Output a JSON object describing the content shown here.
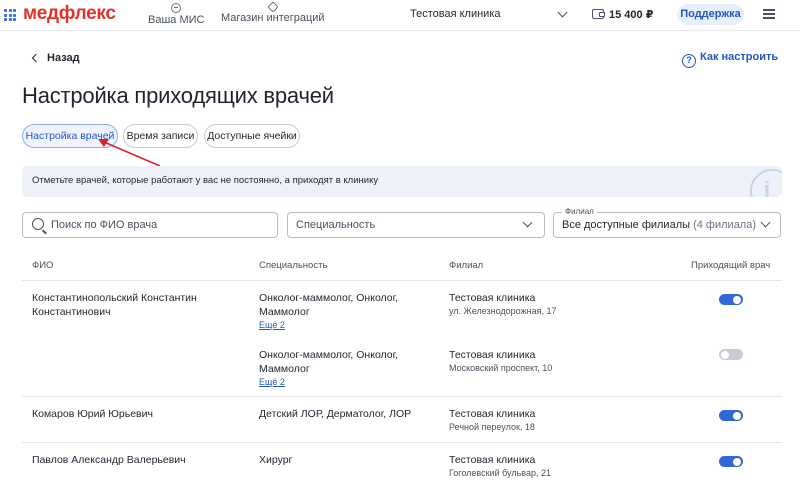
{
  "topbar": {
    "logo": "медфлекс",
    "nav": [
      {
        "label": "Ваша МИС",
        "icon": "arrow-circle-icon"
      },
      {
        "label": "Магазин интеграций",
        "icon": "diamond-icon"
      }
    ],
    "clinic": "Тестовая клиника",
    "balance": "15 400 ₽",
    "support_label": "Поддержка"
  },
  "back_label": "Назад",
  "help_label": "Как настроить",
  "page_title": "Настройка приходящих врачей",
  "tabs": [
    {
      "label": "Настройка врачей",
      "active": true
    },
    {
      "label": "Время записи",
      "active": false
    },
    {
      "label": "Доступные ячейки",
      "active": false
    }
  ],
  "banner": {
    "text": "Отметьте врачей, которые работают у вас не постоянно, а приходят в клинику",
    "icon": "i"
  },
  "filters": {
    "search_placeholder": "Поиск по ФИО врача",
    "specialty_placeholder": "Специальность",
    "branch_label": "Филиал",
    "branch_value": "Все доступные филиалы",
    "branch_count": "(4 филиала)"
  },
  "table": {
    "headers": [
      "ФИО",
      "Специальность",
      "Филиал",
      "Приходящий врач"
    ],
    "rows": [
      {
        "name": "Константинопольский Константин Константинович",
        "entries": [
          {
            "specialty": "Онколог-маммолог, Онколог, Маммолог",
            "more": "Ещё 2",
            "branch": "Тестовая клиника",
            "address": "ул. Железнодорожная, 17",
            "incoming": true
          },
          {
            "specialty": "Онколог-маммолог, Онколог, Маммолог",
            "more": "Ещё 2",
            "branch": "Тестовая клиника",
            "address": "Московский проспект, 10",
            "incoming": false
          }
        ]
      },
      {
        "name": "Комаров Юрий Юрьевич",
        "entries": [
          {
            "specialty": "Детский ЛОР, Дерматолог, ЛОР",
            "branch": "Тестовая клиника",
            "address": "Речной переулок, 18",
            "incoming": true
          }
        ]
      },
      {
        "name": "Павлов Александр Валерьевич",
        "entries": [
          {
            "specialty": "Хирург",
            "branch": "Тестовая клиника",
            "address": "Гоголевский бульвар, 21",
            "incoming": true
          }
        ]
      }
    ]
  },
  "colors": {
    "brand": "#e4322b",
    "accent": "#2457c5",
    "toggle_on": "#3366d6",
    "annotation_arrow": "#e02020"
  }
}
